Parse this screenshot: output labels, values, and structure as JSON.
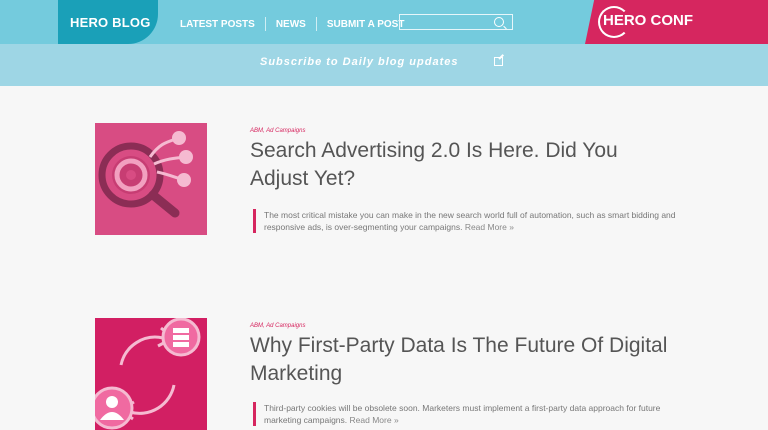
{
  "header": {
    "logo": "HERO BLOG",
    "nav": [
      {
        "label": "LATEST POSTS"
      },
      {
        "label": "NEWS"
      },
      {
        "label": "SUBMIT A POST"
      }
    ],
    "search_placeholder": "",
    "conf_logo": "HERO CONF"
  },
  "subbar": {
    "text": "Subscribe to Daily blog updates"
  },
  "posts": [
    {
      "category": "ABM, Ad Campaigns",
      "title": "Search Advertising 2.0 Is Here. Did You Adjust Yet?",
      "excerpt": "The most critical mistake you can make in the new search world full of automation, such as smart bidding and responsive ads, is over-segmenting your campaigns.",
      "read_more": "Read More »"
    },
    {
      "category": "ABM, Ad Campaigns",
      "title": "Why First-Party Data Is The Future Of Digital Marketing",
      "excerpt": "Third-party cookies will be obsolete soon. Marketers must implement a first-party data approach for future marketing campaigns.",
      "read_more": "Read More »"
    }
  ]
}
